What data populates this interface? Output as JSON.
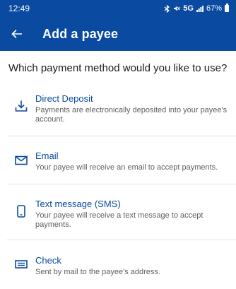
{
  "status_bar": {
    "time": "12:49",
    "icons": [
      "bluetooth-icon",
      "mute-icon",
      "signal-icon",
      "battery-icon"
    ],
    "network": "5G",
    "battery": "67%"
  },
  "app_bar": {
    "title": "Add a payee",
    "back_icon": "arrow-left-icon",
    "background": "#0a4aa0"
  },
  "question": "Which payment method would you like to use?",
  "options": [
    {
      "title": "Direct Deposit",
      "description": "Payments are electronically deposited into your payee's account.",
      "icon": "download-icon"
    },
    {
      "title": "Email",
      "description": "Your payee will receive an email to accept payments.",
      "icon": "envelope-icon"
    },
    {
      "title": "Text message (SMS)",
      "description": "Your payee will receive a text message to accept payments.",
      "icon": "phone-icon"
    },
    {
      "title": "Check",
      "description": "Sent by mail to the payee's address.",
      "icon": "check-icon"
    }
  ],
  "accent": "#0a4aa0"
}
